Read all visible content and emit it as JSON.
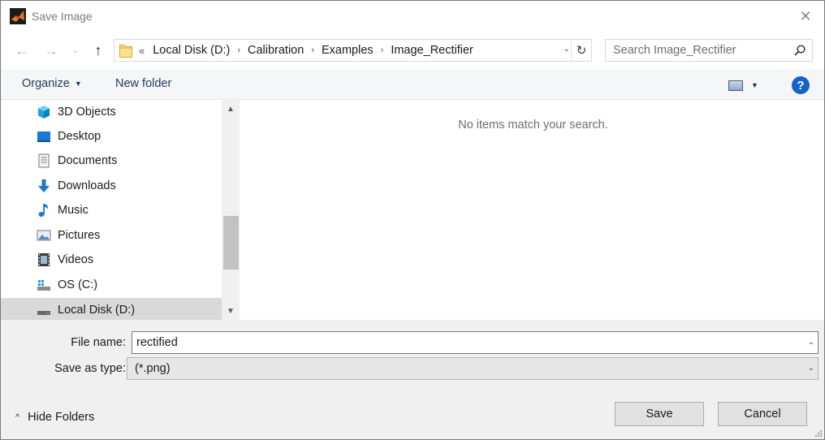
{
  "window": {
    "title": "Save Image",
    "close_glyph": "✕"
  },
  "navigation": {
    "back_glyph": "←",
    "forward_glyph": "→",
    "recent_glyph": "⌄",
    "up_glyph": "↑",
    "address": {
      "overflow_glyph": "«",
      "crumbs": [
        "Local Disk (D:)",
        "Calibration",
        "Examples",
        "Image_Rectifier"
      ],
      "separator_glyph": "›",
      "dropdown_glyph": "⌄",
      "refresh_glyph": "↻"
    },
    "search": {
      "placeholder": "Search Image_Rectifier",
      "value": ""
    }
  },
  "commandbar": {
    "organize_label": "Organize",
    "organize_caret": "▼",
    "new_folder_label": "New folder",
    "view_caret": "▼",
    "help_glyph": "?"
  },
  "nav_pane": {
    "items": [
      {
        "label": "3D Objects",
        "icon": "3d-objects-icon",
        "selected": false
      },
      {
        "label": "Desktop",
        "icon": "desktop-icon",
        "selected": false
      },
      {
        "label": "Documents",
        "icon": "documents-icon",
        "selected": false
      },
      {
        "label": "Downloads",
        "icon": "downloads-icon",
        "selected": false
      },
      {
        "label": "Music",
        "icon": "music-icon",
        "selected": false
      },
      {
        "label": "Pictures",
        "icon": "pictures-icon",
        "selected": false
      },
      {
        "label": "Videos",
        "icon": "videos-icon",
        "selected": false
      },
      {
        "label": "OS (C:)",
        "icon": "os-drive-icon",
        "selected": false
      },
      {
        "label": "Local Disk (D:)",
        "icon": "local-disk-icon",
        "selected": true
      }
    ],
    "scroll_up_glyph": "▲",
    "scroll_down_glyph": "▼"
  },
  "content": {
    "empty_message": "No items match your search."
  },
  "form": {
    "file_name_label": "File name:",
    "file_name_value": "rectified",
    "save_as_type_label": "Save as type:",
    "save_as_type_value": "(*.png)",
    "dropdown_glyph": "⌄",
    "hide_folders_label": "Hide Folders",
    "hide_folders_glyph": "^",
    "save_label": "Save",
    "cancel_label": "Cancel"
  },
  "colors": {
    "accent_link": "#1e395b",
    "help_blue": "#1363c9",
    "selected_row": "#d9d9d9"
  }
}
